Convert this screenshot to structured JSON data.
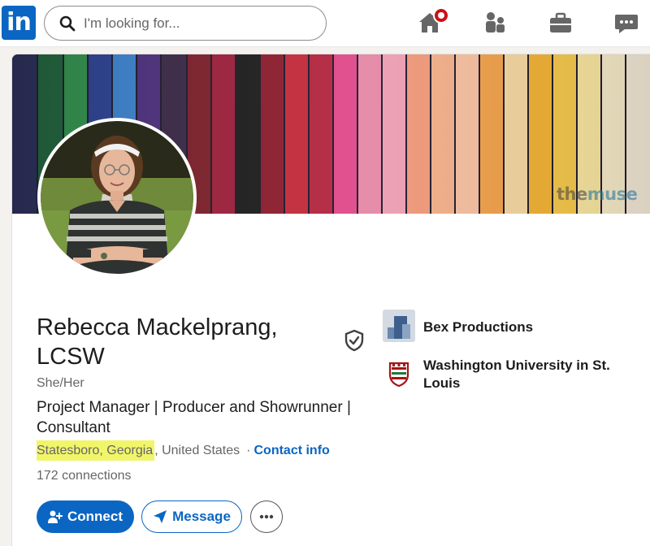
{
  "nav": {
    "logo_text": "in",
    "search_placeholder": "I'm looking for...",
    "icons": [
      "home-icon",
      "my-network-icon",
      "jobs-icon",
      "messaging-icon"
    ],
    "accent_color": "#0a66c2",
    "badge_color": "#cc1016"
  },
  "banner": {
    "watermark_a": "the",
    "watermark_b": "muse"
  },
  "profile": {
    "name": "Rebecca Mackelprang, LCSW",
    "pronouns": "She/Her",
    "headline": "Project Manager | Producer and Showrunner | Consultant",
    "location_highlighted": "Statesboro, Georgia",
    "location_rest": ", United States",
    "separator": "·",
    "contact_info": "Contact info",
    "connections": "172 connections",
    "verified_icon": "shield-check-icon"
  },
  "actions": {
    "connect": "Connect",
    "message": "Message",
    "more_icon": "ellipsis-icon"
  },
  "organizations": [
    {
      "name": "Bex Productions",
      "logo": "bex-productions-logo"
    },
    {
      "name": "Washington University in St. Louis",
      "logo": "washu-logo"
    }
  ]
}
